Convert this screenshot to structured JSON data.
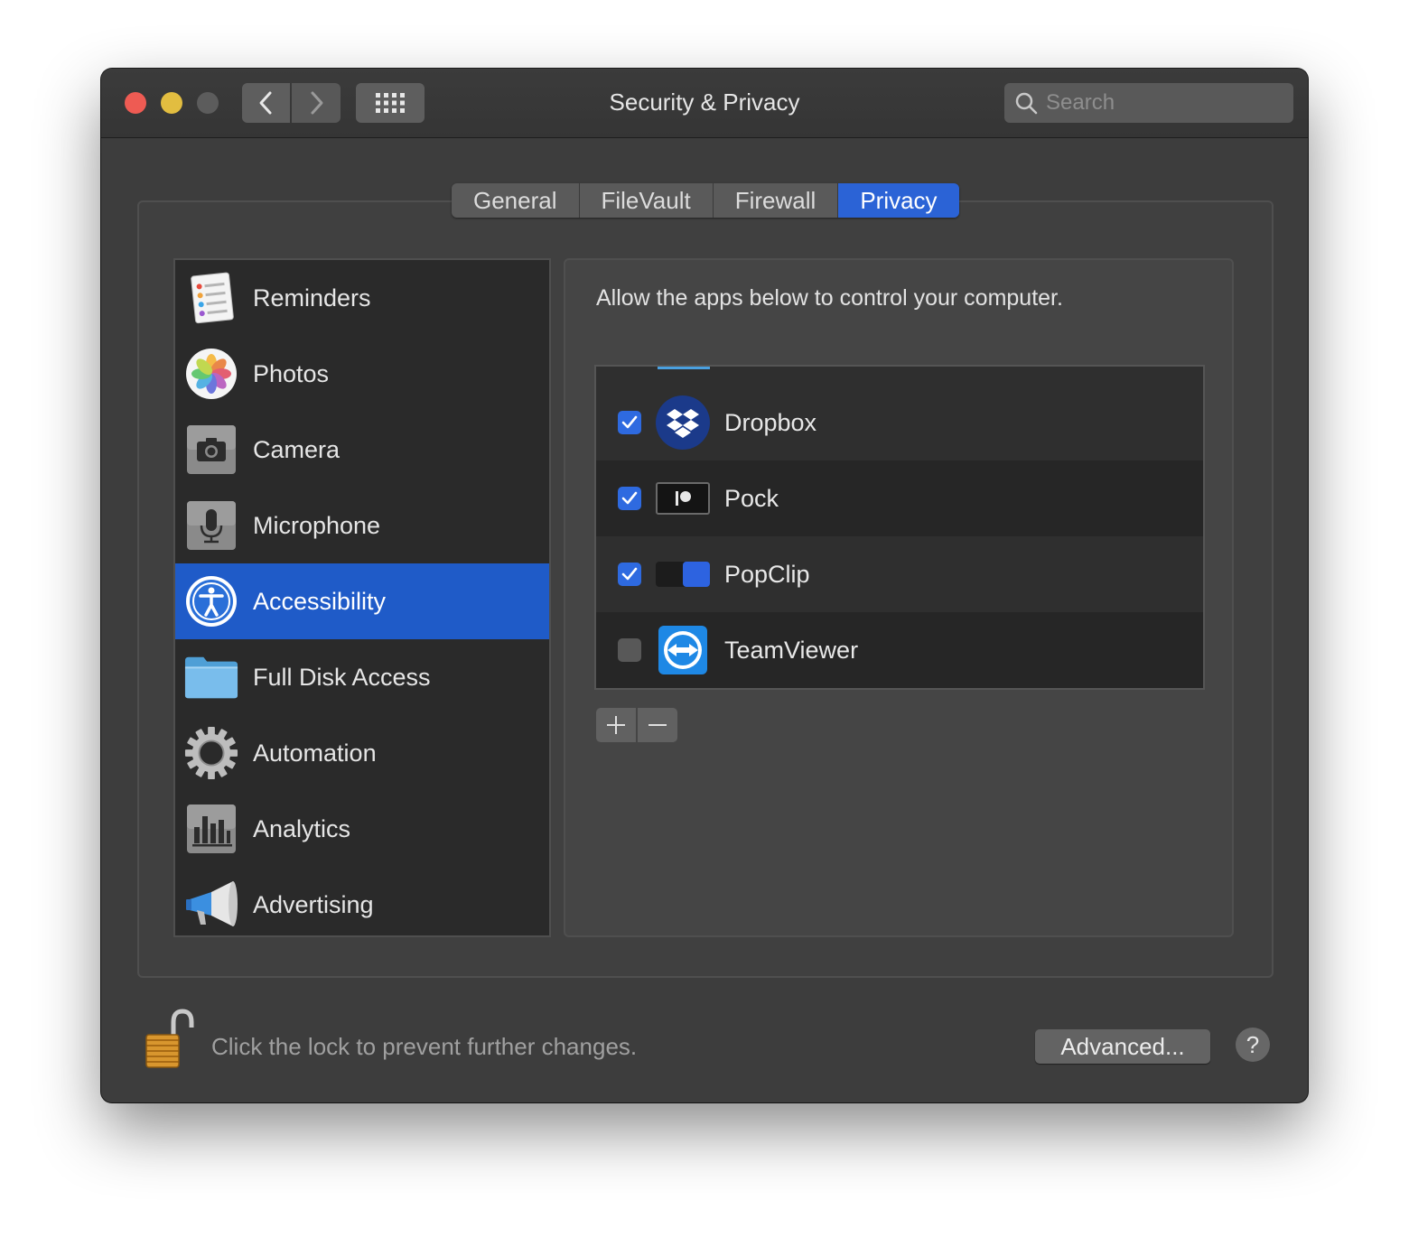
{
  "window": {
    "title": "Security & Privacy"
  },
  "search": {
    "placeholder": "Search"
  },
  "tabs": [
    {
      "label": "General"
    },
    {
      "label": "FileVault"
    },
    {
      "label": "Firewall"
    },
    {
      "label": "Privacy",
      "active": true
    }
  ],
  "sidebar": {
    "items": [
      {
        "label": "Reminders",
        "icon": "reminders-icon"
      },
      {
        "label": "Photos",
        "icon": "photos-icon"
      },
      {
        "label": "Camera",
        "icon": "camera-icon"
      },
      {
        "label": "Microphone",
        "icon": "microphone-icon"
      },
      {
        "label": "Accessibility",
        "icon": "accessibility-icon",
        "selected": true
      },
      {
        "label": "Full Disk Access",
        "icon": "folder-icon"
      },
      {
        "label": "Automation",
        "icon": "gear-icon"
      },
      {
        "label": "Analytics",
        "icon": "analytics-icon"
      },
      {
        "label": "Advertising",
        "icon": "megaphone-icon"
      }
    ]
  },
  "content": {
    "description": "Allow the apps below to control your computer.",
    "apps": [
      {
        "label": "Dropbox",
        "checked": true,
        "icon": "dropbox-icon"
      },
      {
        "label": "Pock",
        "checked": true,
        "icon": "pock-icon"
      },
      {
        "label": "PopClip",
        "checked": true,
        "icon": "popclip-icon"
      },
      {
        "label": "TeamViewer",
        "checked": false,
        "icon": "teamviewer-icon"
      }
    ]
  },
  "footer": {
    "lock_text": "Click the lock to prevent further changes.",
    "advanced_label": "Advanced...",
    "help_label": "?"
  },
  "colors": {
    "accent": "#2b63d6",
    "window_bg": "#3d3d3d",
    "list_bg": "#2a2a2a"
  }
}
